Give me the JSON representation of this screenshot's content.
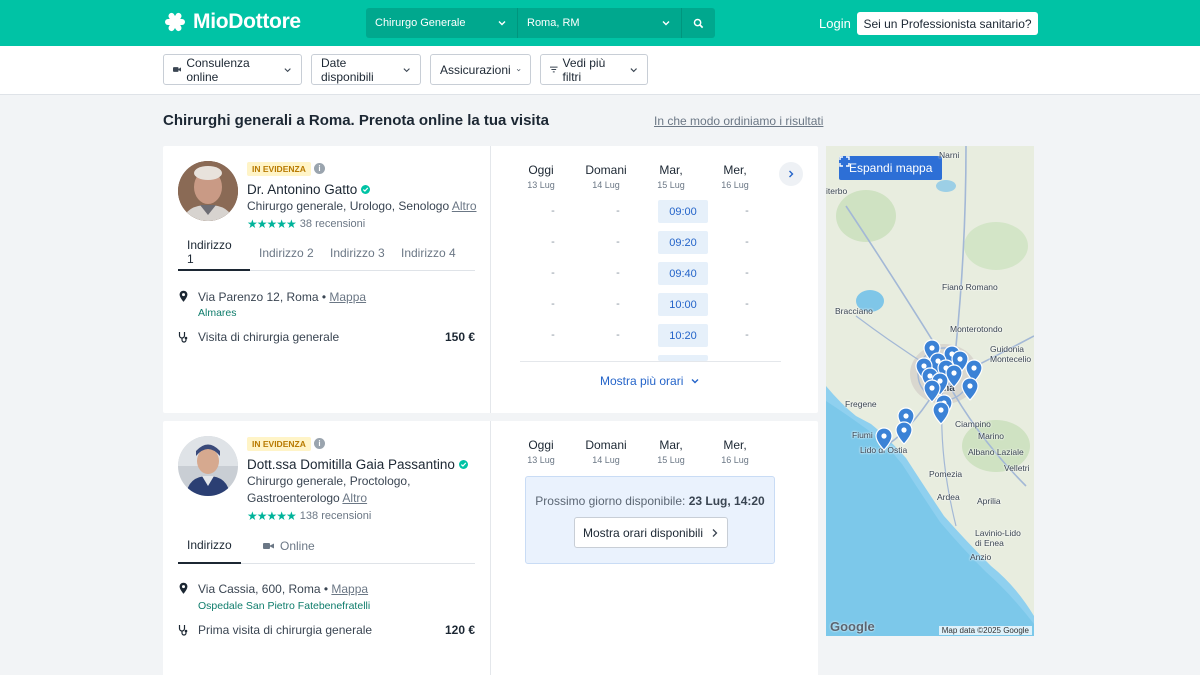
{
  "header": {
    "logo_text": "MioDottore",
    "search_specialty": "Chirurgo Generale",
    "search_location": "Roma, RM",
    "login": "Login",
    "pro_button": "Sei un Professionista sanitario?"
  },
  "filters": {
    "online": "Consulenza online",
    "dates": "Date disponibili",
    "insurance": "Assicurazioni",
    "more": "Vedi più filtri"
  },
  "page": {
    "title": "Chirurghi generali a Roma. Prenota online la tua visita",
    "order_link": "In che modo ordiniamo i risultati"
  },
  "days": [
    {
      "name": "Oggi",
      "date": "13 Lug"
    },
    {
      "name": "Domani",
      "date": "14 Lug"
    },
    {
      "name": "Mar,",
      "date": "15 Lug"
    },
    {
      "name": "Mer,",
      "date": "16 Lug"
    }
  ],
  "doctors": [
    {
      "badge": "IN EVIDENZA",
      "name": "Dr. Antonino Gatto",
      "specialties": "Chirurgo generale, Urologo, Senologo",
      "more_link": "Altro",
      "rating_stars": "★★★★★",
      "reviews": "38 recensioni",
      "tabs": [
        "Indirizzo 1",
        "Indirizzo 2",
        "Indirizzo 3",
        "Indirizzo 4"
      ],
      "address": "Via Parenzo 12, Roma",
      "map_link": "Mappa",
      "place": "Almares",
      "service": "Visita di chirurgia generale",
      "price": "150 €",
      "slots": [
        "09:00",
        "09:20",
        "09:40",
        "10:00",
        "10:20"
      ],
      "dash": "-",
      "more_hours": "Mostra più orari"
    },
    {
      "badge": "IN EVIDENZA",
      "name": "Dott.ssa Domitilla Gaia Passantino",
      "specialties_line1": "Chirurgo generale, Proctologo,",
      "specialties_line2": "Gastroenterologo",
      "more_link": "Altro",
      "rating_stars": "★★★★★",
      "reviews": "138 recensioni",
      "tabs": [
        "Indirizzo",
        "Online"
      ],
      "address": "Via Cassia, 600, Roma",
      "map_link": "Mappa",
      "place": "Ospedale San Pietro Fatebenefratelli",
      "service": "Prima visita di chirurgia generale",
      "price": "120 €",
      "next_label": "Prossimo giorno disponibile:",
      "next_value": "23 Lug, 14:20",
      "show_hours": "Mostra orari disponibili"
    }
  ],
  "map": {
    "expand": "Espandi mappa",
    "labels": {
      "narni": "Narni",
      "viterbo": "iterbo",
      "fiano": "Fiano Romano",
      "bracciano": "Bracciano",
      "monterotondo": "Monterotondo",
      "guidonia": "Guidonia\nMontecelio",
      "roma": "Roma",
      "fregene": "Fregene",
      "fiumicino": "Fiumi",
      "ostia": "Lido di Ostia",
      "ciampino": "Ciampino",
      "marino": "Marino",
      "albano": "Albano Laziale",
      "velletri": "Velletri",
      "pomezia": "Pomezia",
      "ardea": "Ardea",
      "aprilia": "Aprilia",
      "lavinio": "Lavinio-Lido\ndi Enea",
      "anzio": "Anzio"
    },
    "google": "Google",
    "credit": "Map data ©2025 Google"
  },
  "colors": {
    "brand": "#00c3a5",
    "slot_text": "#2464c9",
    "slot_bg": "#e6f0fa",
    "map_button": "#2d6fd6"
  }
}
